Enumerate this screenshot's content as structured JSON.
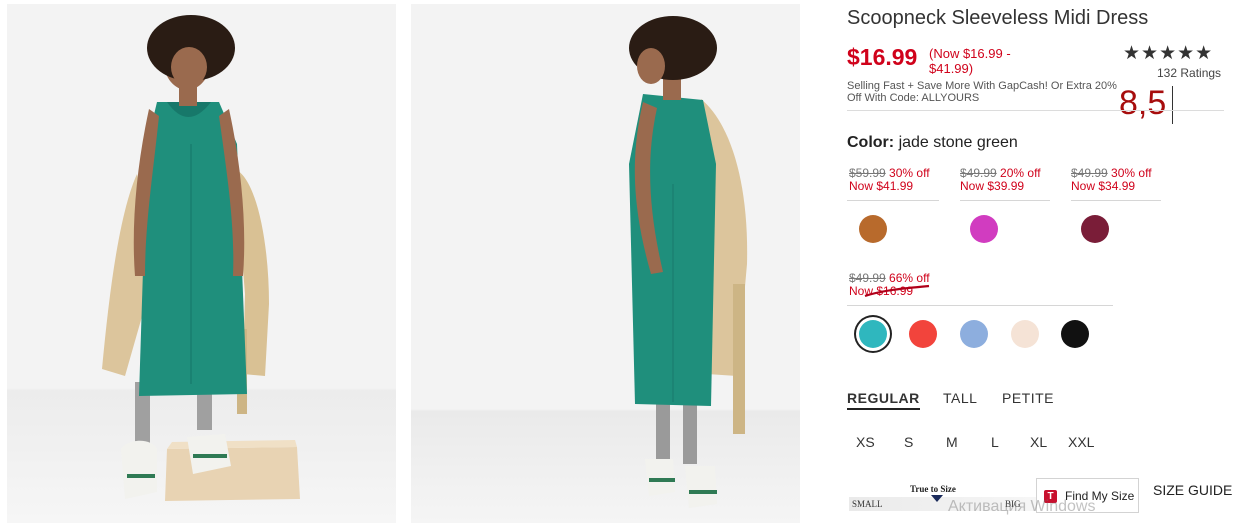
{
  "product": {
    "title": "Scoopneck Sleeveless Midi Dress",
    "price": "$16.99",
    "price_range": "(Now $16.99 - $41.99)",
    "promo": "Selling Fast + Save More With GapCash! Or Extra 20% Off With Code: ALLYOURS",
    "stars": "★★★★★",
    "rating_value": 4.5,
    "ratings_count": "132 Ratings",
    "overlay_number": "8,5"
  },
  "color": {
    "label": "Color:",
    "value": "jade stone green"
  },
  "deals": [
    {
      "was": "$59.99",
      "off": "30% off",
      "now": "Now $41.99"
    },
    {
      "was": "$49.99",
      "off": "20% off",
      "now": "Now $39.99"
    },
    {
      "was": "$49.99",
      "off": "30% off",
      "now": "Now $34.99"
    },
    {
      "was": "$49.99",
      "off": "66% off",
      "now": "Now $16.99"
    }
  ],
  "swatches": [
    {
      "name": "brown",
      "color": "#b86a2c",
      "selected": false
    },
    {
      "name": "magenta",
      "color": "#d13cc0",
      "selected": false
    },
    {
      "name": "burgundy",
      "color": "#7a1d38",
      "selected": false
    },
    {
      "name": "jade",
      "color": "#2fb7be",
      "selected": true
    },
    {
      "name": "coral-red",
      "color": "#f2443c",
      "selected": false
    },
    {
      "name": "light-blue",
      "color": "#8daede",
      "selected": false
    },
    {
      "name": "cream",
      "color": "#f5e3d6",
      "selected": false
    },
    {
      "name": "black",
      "color": "#111111",
      "selected": false
    }
  ],
  "fit_tabs": [
    {
      "label": "REGULAR",
      "active": true
    },
    {
      "label": "TALL",
      "active": false
    },
    {
      "label": "PETITE",
      "active": false
    }
  ],
  "sizes": [
    "XS",
    "S",
    "M",
    "L",
    "XL",
    "XXL"
  ],
  "true_to_size": {
    "label": "True to Size",
    "small": "SMALL",
    "big": "BIG"
  },
  "find_my_size": "Find My Size",
  "size_guide": "SIZE GUIDE",
  "watermark": "Активация Windows"
}
